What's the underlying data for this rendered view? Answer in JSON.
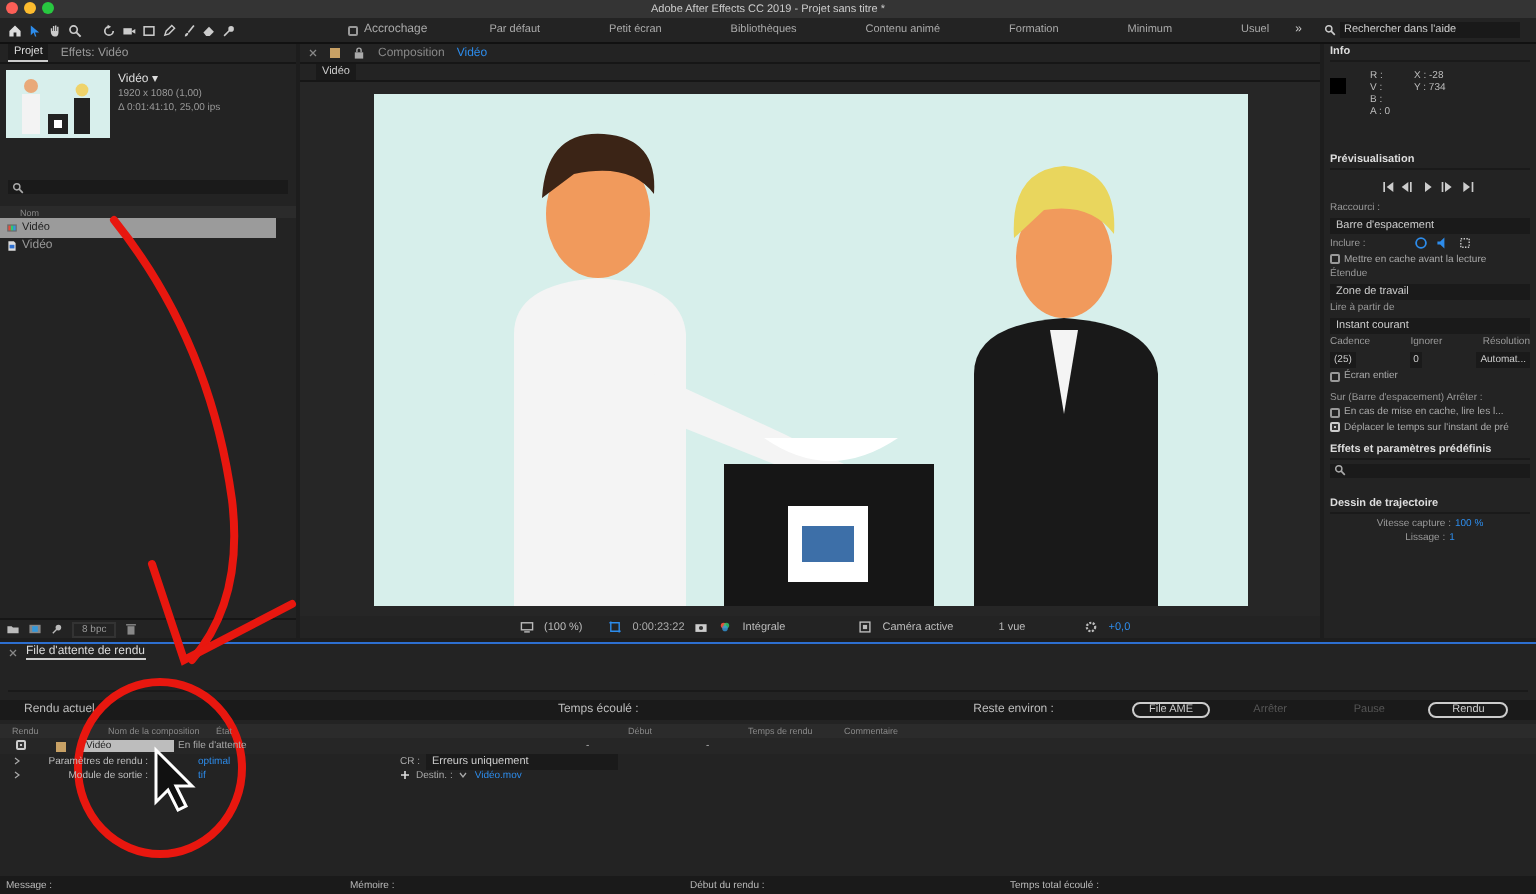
{
  "window": {
    "title": "Adobe After Effects CC 2019 - Projet sans titre *"
  },
  "toolbar": {
    "snapping": {
      "label": "Accrochage",
      "checked": false
    },
    "workspaces": [
      "Par défaut",
      "Petit écran",
      "Bibliothèques",
      "Contenu animé",
      "Formation",
      "Minimum",
      "Usuel"
    ],
    "more": "»",
    "search": {
      "placeholder": "Rechercher dans l'aide"
    }
  },
  "project_panel": {
    "tabs": [
      {
        "label": "Projet",
        "selected": true
      },
      {
        "label": "Effets: Vidéo",
        "selected": false
      }
    ],
    "preview": {
      "name": "Vidéo ▾",
      "size": "1920 x 1080 (1,00)",
      "duration": "Δ 0:01:41:10, 25,00 ips"
    },
    "column": "Nom",
    "items": [
      {
        "name": "Vidéo",
        "kind": "composition",
        "selected": true
      },
      {
        "name": "Vidéo",
        "kind": "footage",
        "selected": false
      }
    ],
    "bpc": "8 bpc"
  },
  "composition_panel": {
    "title": "Composition",
    "name": "Vidéo",
    "tabs": [
      {
        "label": "Vidéo",
        "selected": true
      }
    ],
    "viewer_toolbar": {
      "zoom": "(100 %)",
      "time": "0:00:23:22",
      "resolution": "Intégrale",
      "camera": "Caméra active",
      "views": "1 vue",
      "exposure": "+0,0"
    }
  },
  "info_panel": {
    "title": "Info",
    "channels": [
      "R :",
      "V :",
      "B :",
      "A : 0"
    ],
    "coords": [
      "X : -28",
      "Y : 734"
    ]
  },
  "preview_panel": {
    "title": "Prévisualisation",
    "shortcut_label": "Raccourci :",
    "shortcut": "Barre d'espacement",
    "include_label": "Inclure :",
    "cache": {
      "label": "Mettre en cache avant la lecture",
      "checked": false
    },
    "range_label": "Étendue",
    "range": "Zone de travail",
    "play_from_label": "Lire à partir de",
    "play_from": "Instant courant",
    "rate_labels": [
      "Cadence",
      "Ignorer",
      "Résolution"
    ],
    "rate_values": [
      "(25)",
      "0",
      "Automat..."
    ],
    "fullscreen": {
      "label": "Écran entier",
      "checked": false
    },
    "stop_label": "Sur (Barre d'espacement) Arrêter :",
    "stop_options": [
      {
        "label": "En cas de mise en cache, lire les l...",
        "checked": false
      },
      {
        "label": "Déplacer le temps sur l'instant de pré",
        "checked": true
      }
    ]
  },
  "effects_panel": {
    "title": "Effets et paramètres prédéfinis"
  },
  "motion_sketch": {
    "title": "Dessin de trajectoire",
    "capture_label": "Vitesse capture :",
    "capture_value": "100 %",
    "smoothing_label": "Lissage :",
    "smoothing_value": "1"
  },
  "render_queue": {
    "tab": "File d'attente de rendu",
    "current_label": "Rendu actuel",
    "elapsed_label": "Temps écoulé :",
    "remaining_label": "Reste environ :",
    "buttons": [
      {
        "label": "File AME",
        "disabled": false
      },
      {
        "label": "Arrêter",
        "disabled": true
      },
      {
        "label": "Pause",
        "disabled": true
      },
      {
        "label": "Rendu",
        "disabled": false
      }
    ],
    "columns": [
      "Rendu",
      "Nom de la composition",
      "État",
      "Début",
      "Temps de rendu",
      "Commentaire"
    ],
    "rows": [
      {
        "checked": true,
        "color": "#c8a165",
        "name": "Vidéo",
        "status": "En file d'attente",
        "start": "-",
        "render_time": "-"
      }
    ],
    "settings": [
      {
        "label": "Paramètres de rendu :",
        "value": "optimal"
      },
      {
        "label": "Module de sortie :",
        "value": "tif"
      }
    ],
    "log": {
      "label": "CR :",
      "value": "Erreurs uniquement"
    },
    "output": {
      "label": "Destin. :",
      "value": "Vidéo.mov"
    },
    "footer": [
      "Message :",
      "Mémoire :",
      "Début du rendu :",
      "Temps total écoulé :"
    ]
  }
}
